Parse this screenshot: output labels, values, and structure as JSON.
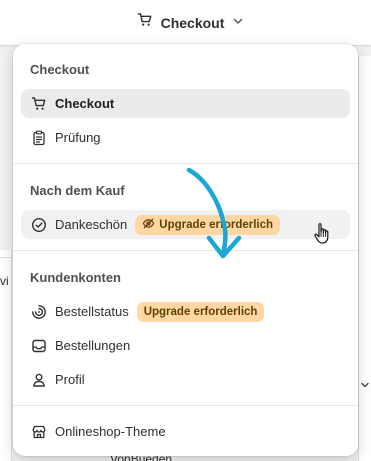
{
  "topbar": {
    "trigger_label": "Checkout",
    "icon": "cart-icon"
  },
  "background": {
    "left_fragment": "vi",
    "bottom_fragment": "VonBueden",
    "chevron_icon": "chevron-down-icon"
  },
  "dropdown": {
    "sections": [
      {
        "heading": "Checkout",
        "items": [
          {
            "label": "Checkout",
            "icon": "cart-icon",
            "selected": true
          },
          {
            "label": "Prüfung",
            "icon": "clipboard-icon"
          }
        ]
      },
      {
        "heading": "Nach dem Kauf",
        "items": [
          {
            "label": "Dankeschön",
            "icon": "check-circle-icon",
            "badge": "Upgrade erforderlich",
            "badge_icon": "eye-off-icon",
            "hovered": true
          }
        ]
      },
      {
        "heading": "Kundenkonten",
        "items": [
          {
            "label": "Bestellstatus",
            "icon": "status-icon",
            "badge": "Upgrade erforderlich"
          },
          {
            "label": "Bestellungen",
            "icon": "inbox-icon"
          },
          {
            "label": "Profil",
            "icon": "person-icon"
          }
        ]
      },
      {
        "items": [
          {
            "label": "Onlineshop-Theme",
            "icon": "store-icon"
          }
        ]
      }
    ]
  },
  "colors": {
    "badge_bg": "#ffd6a4",
    "badge_text": "#5e4200",
    "selected_bg": "#ebebeb",
    "arrow": "#1aa7d4"
  }
}
